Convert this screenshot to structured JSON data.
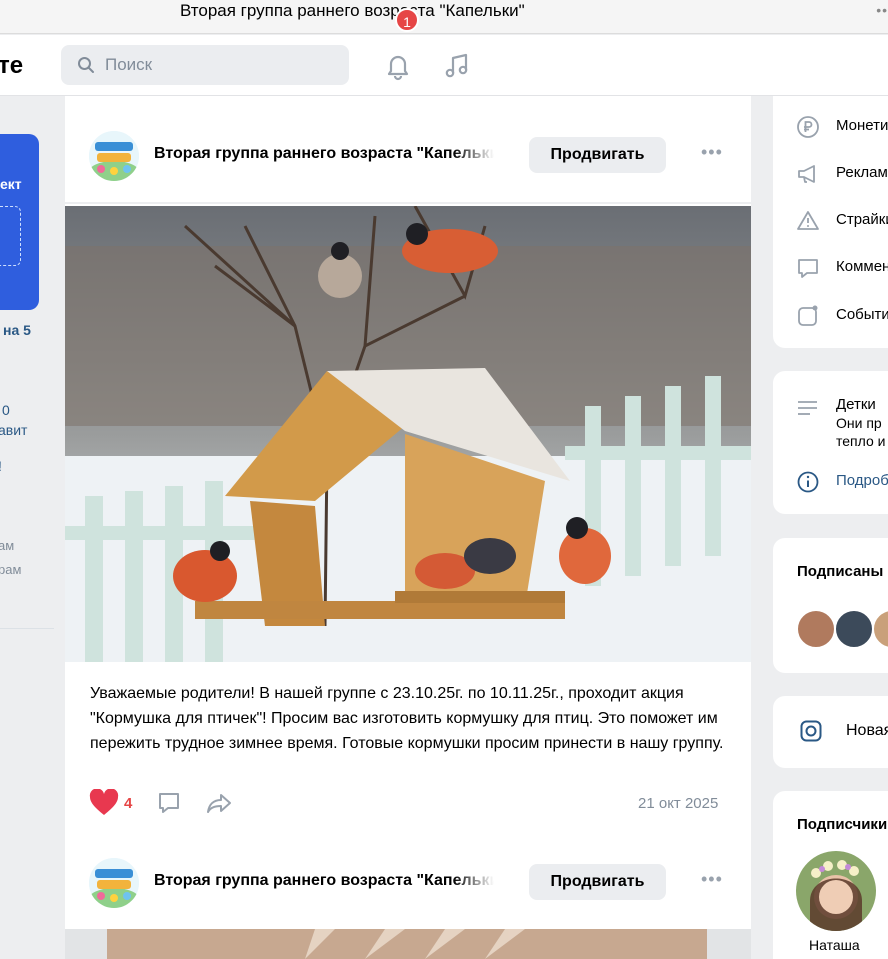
{
  "window": {
    "title": "Вторая группа раннего возраста \"Капельки\""
  },
  "header": {
    "logo_text": "те",
    "search_placeholder": "Поиск",
    "notifications_count": "1"
  },
  "left": {
    "promo_text": "ект",
    "texts": [
      "на 5",
      "0",
      "авит",
      "!",
      "ам",
      "рам"
    ]
  },
  "posts": [
    {
      "group_name": "Вторая группа раннего возраста \"Капельки\"",
      "promote_label": "Продвигать",
      "more_label": "•••",
      "text": "Уважаемые родители! В нашей группе с 23.10.25г. по 10.11.25г., проходит акция \"Кормушка для птичек\"! Просим вас изготовить кормушку для птиц. Это поможет им пережить трудное зимнее время. Готовые кормушки просим принести в нашу группу.",
      "likes": "4",
      "date": "21 окт 2025"
    },
    {
      "group_name": "Вторая группа раннего возраста \"Капельки\"",
      "promote_label": "Продвигать",
      "more_label": "•••"
    }
  ],
  "right": {
    "menu": [
      {
        "label": "Монетизация",
        "icon": "ruble-icon"
      },
      {
        "label": "Реклама",
        "icon": "megaphone-icon"
      },
      {
        "label": "Страйки",
        "icon": "warning-icon"
      },
      {
        "label": "Комментарии",
        "icon": "comment-icon"
      },
      {
        "label": "События",
        "icon": "event-icon"
      }
    ],
    "about": {
      "title": "Детки",
      "line1": "Они пр",
      "line2": "тепло и",
      "more_link": "Подробнее"
    },
    "subscriptions_title": "Подписаны",
    "instagram_label": "Новая",
    "subscribers_title": "Подписчики",
    "subscriber_name": "Наташа"
  },
  "colors": {
    "accent": "#2a5885",
    "badge": "#e64646",
    "promo": "#2f5ede"
  }
}
